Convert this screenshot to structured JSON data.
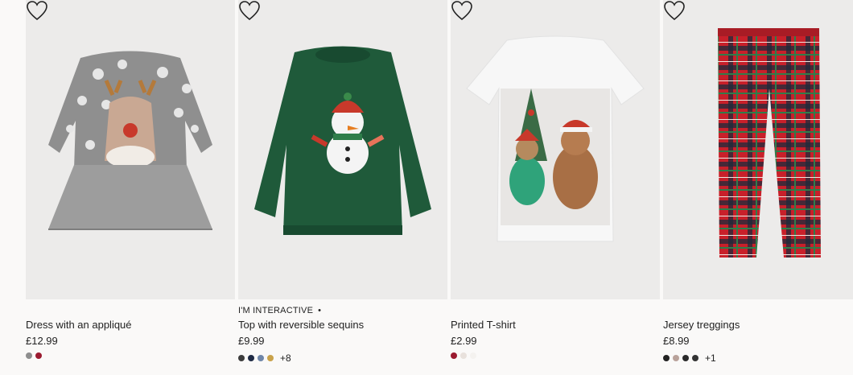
{
  "products": [
    {
      "title": "Dress with an appliqué",
      "price": "£12.99",
      "marker": "",
      "swatches": [
        "#8e8e8e",
        "#9b1b30"
      ],
      "more_colors": ""
    },
    {
      "title": "Top with reversible sequins",
      "price": "£9.99",
      "marker": "I'M INTERACTIVE",
      "marker_dot": "•",
      "swatches": [
        "#3c3c3c",
        "#1f2a44",
        "#6f86a8",
        "#c9a24a"
      ],
      "more_colors": "+8"
    },
    {
      "title": "Printed T-shirt",
      "price": "£2.99",
      "marker": "",
      "swatches": [
        "#9b1b30",
        "#e8e1dc",
        "#f4f2ef"
      ],
      "more_colors": ""
    },
    {
      "title": "Jersey treggings",
      "price": "£8.99",
      "marker": "",
      "swatches": [
        "#222222",
        "#b9a29a",
        "#2a2a2a",
        "#333333"
      ],
      "more_colors": "+1"
    }
  ],
  "icons": {
    "favourite": "heart-outline-icon"
  }
}
